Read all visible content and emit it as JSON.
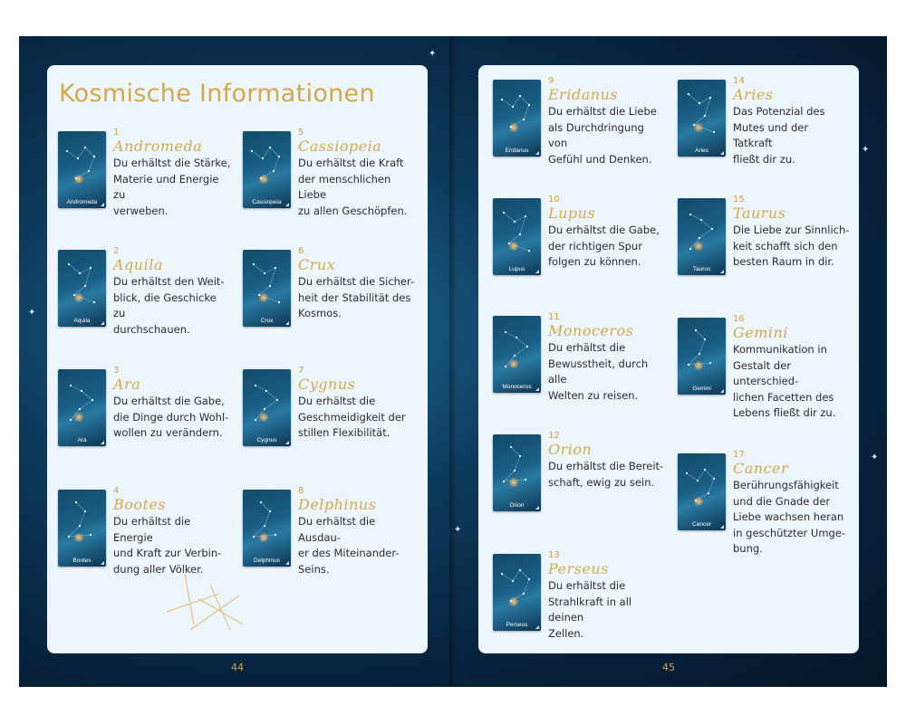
{
  "page_title": "Kosmische Informationen",
  "page_numbers": [
    "44",
    "45"
  ],
  "entries": [
    {
      "num": "1",
      "name": "Andromeda",
      "card": "Andromeda",
      "desc": [
        "Du erhältst die Stärke,",
        "Materie und Energie zu",
        "verweben."
      ]
    },
    {
      "num": "2",
      "name": "Aquila",
      "card": "Aquila",
      "desc": [
        "Du erhältst den Weit-",
        "blick, die Geschicke zu",
        "durchschauen."
      ]
    },
    {
      "num": "3",
      "name": "Ara",
      "card": "Ara",
      "desc": [
        "Du erhältst die Gabe,",
        "die Dinge durch Wohl-",
        "wollen zu verändern."
      ]
    },
    {
      "num": "4",
      "name": "Bootes",
      "card": "Bootes",
      "desc": [
        "Du erhältst die Energie",
        "und Kraft zur Verbin-",
        "dung aller Völker."
      ]
    },
    {
      "num": "5",
      "name": "Cassiopeia",
      "card": "Cassiopeia",
      "desc": [
        "Du erhältst die Kraft",
        "der menschlichen Liebe",
        "zu allen Geschöpfen."
      ]
    },
    {
      "num": "6",
      "name": "Crux",
      "card": "Crux",
      "desc": [
        "Du erhältst die Sicher-",
        "heit der Stabilität des",
        "Kosmos."
      ]
    },
    {
      "num": "7",
      "name": "Cygnus",
      "card": "Cygnus",
      "desc": [
        "Du erhältst die",
        "Geschmeidigkeit der",
        "stillen Flexibilität."
      ]
    },
    {
      "num": "8",
      "name": "Delphinus",
      "card": "Delphinus",
      "desc": [
        "Du erhältst die Ausdau-",
        "er des Miteinander-",
        "Seins."
      ]
    },
    {
      "num": "9",
      "name": "Eridanus",
      "card": "Eridanus",
      "desc": [
        "Du erhältst die Liebe",
        "als Durchdringung von",
        "Gefühl und Denken."
      ]
    },
    {
      "num": "10",
      "name": "Lupus",
      "card": "Lupus",
      "desc": [
        "Du erhältst die Gabe,",
        "der richtigen Spur",
        "folgen zu können."
      ]
    },
    {
      "num": "11",
      "name": "Monoceros",
      "card": "Monoceros",
      "desc": [
        "Du erhältst die",
        "Bewusstheit, durch alle",
        "Welten zu reisen."
      ]
    },
    {
      "num": "12",
      "name": "Orion",
      "card": "Orion",
      "desc": [
        "Du erhältst die Bereit-",
        "schaft, ewig zu sein."
      ]
    },
    {
      "num": "13",
      "name": "Perseus",
      "card": "Perseus",
      "desc": [
        "Du erhältst die",
        "Strahlkraft in all deinen",
        "Zellen."
      ]
    },
    {
      "num": "14",
      "name": "Aries",
      "card": "Aries",
      "desc": [
        "Das Potenzial des",
        "Mutes und der Tatkraft",
        "fließt dir zu."
      ]
    },
    {
      "num": "15",
      "name": "Taurus",
      "card": "Taurus",
      "desc": [
        "Die Liebe zur Sinnlich-",
        "keit schafft sich den",
        "besten Raum in dir."
      ]
    },
    {
      "num": "16",
      "name": "Gemini",
      "card": "Gemini",
      "desc": [
        "Kommunikation in",
        "Gestalt der unterschied-",
        "lichen Facetten des",
        "Lebens fließt dir zu."
      ]
    },
    {
      "num": "17",
      "name": "Cancer",
      "card": "Cancer",
      "desc": [
        "Berührungsfähigkeit",
        "und die Gnade der",
        "Liebe wachsen heran",
        "in geschützter Umge-",
        "bung."
      ]
    }
  ],
  "colors": {
    "gold": "#d2a94b",
    "panel": "#eef6fd",
    "night": "#0d3a5c"
  },
  "icons": {
    "page_ornament": "gold-sparkle-icon",
    "card_corner": "corner-triangle-icon"
  }
}
